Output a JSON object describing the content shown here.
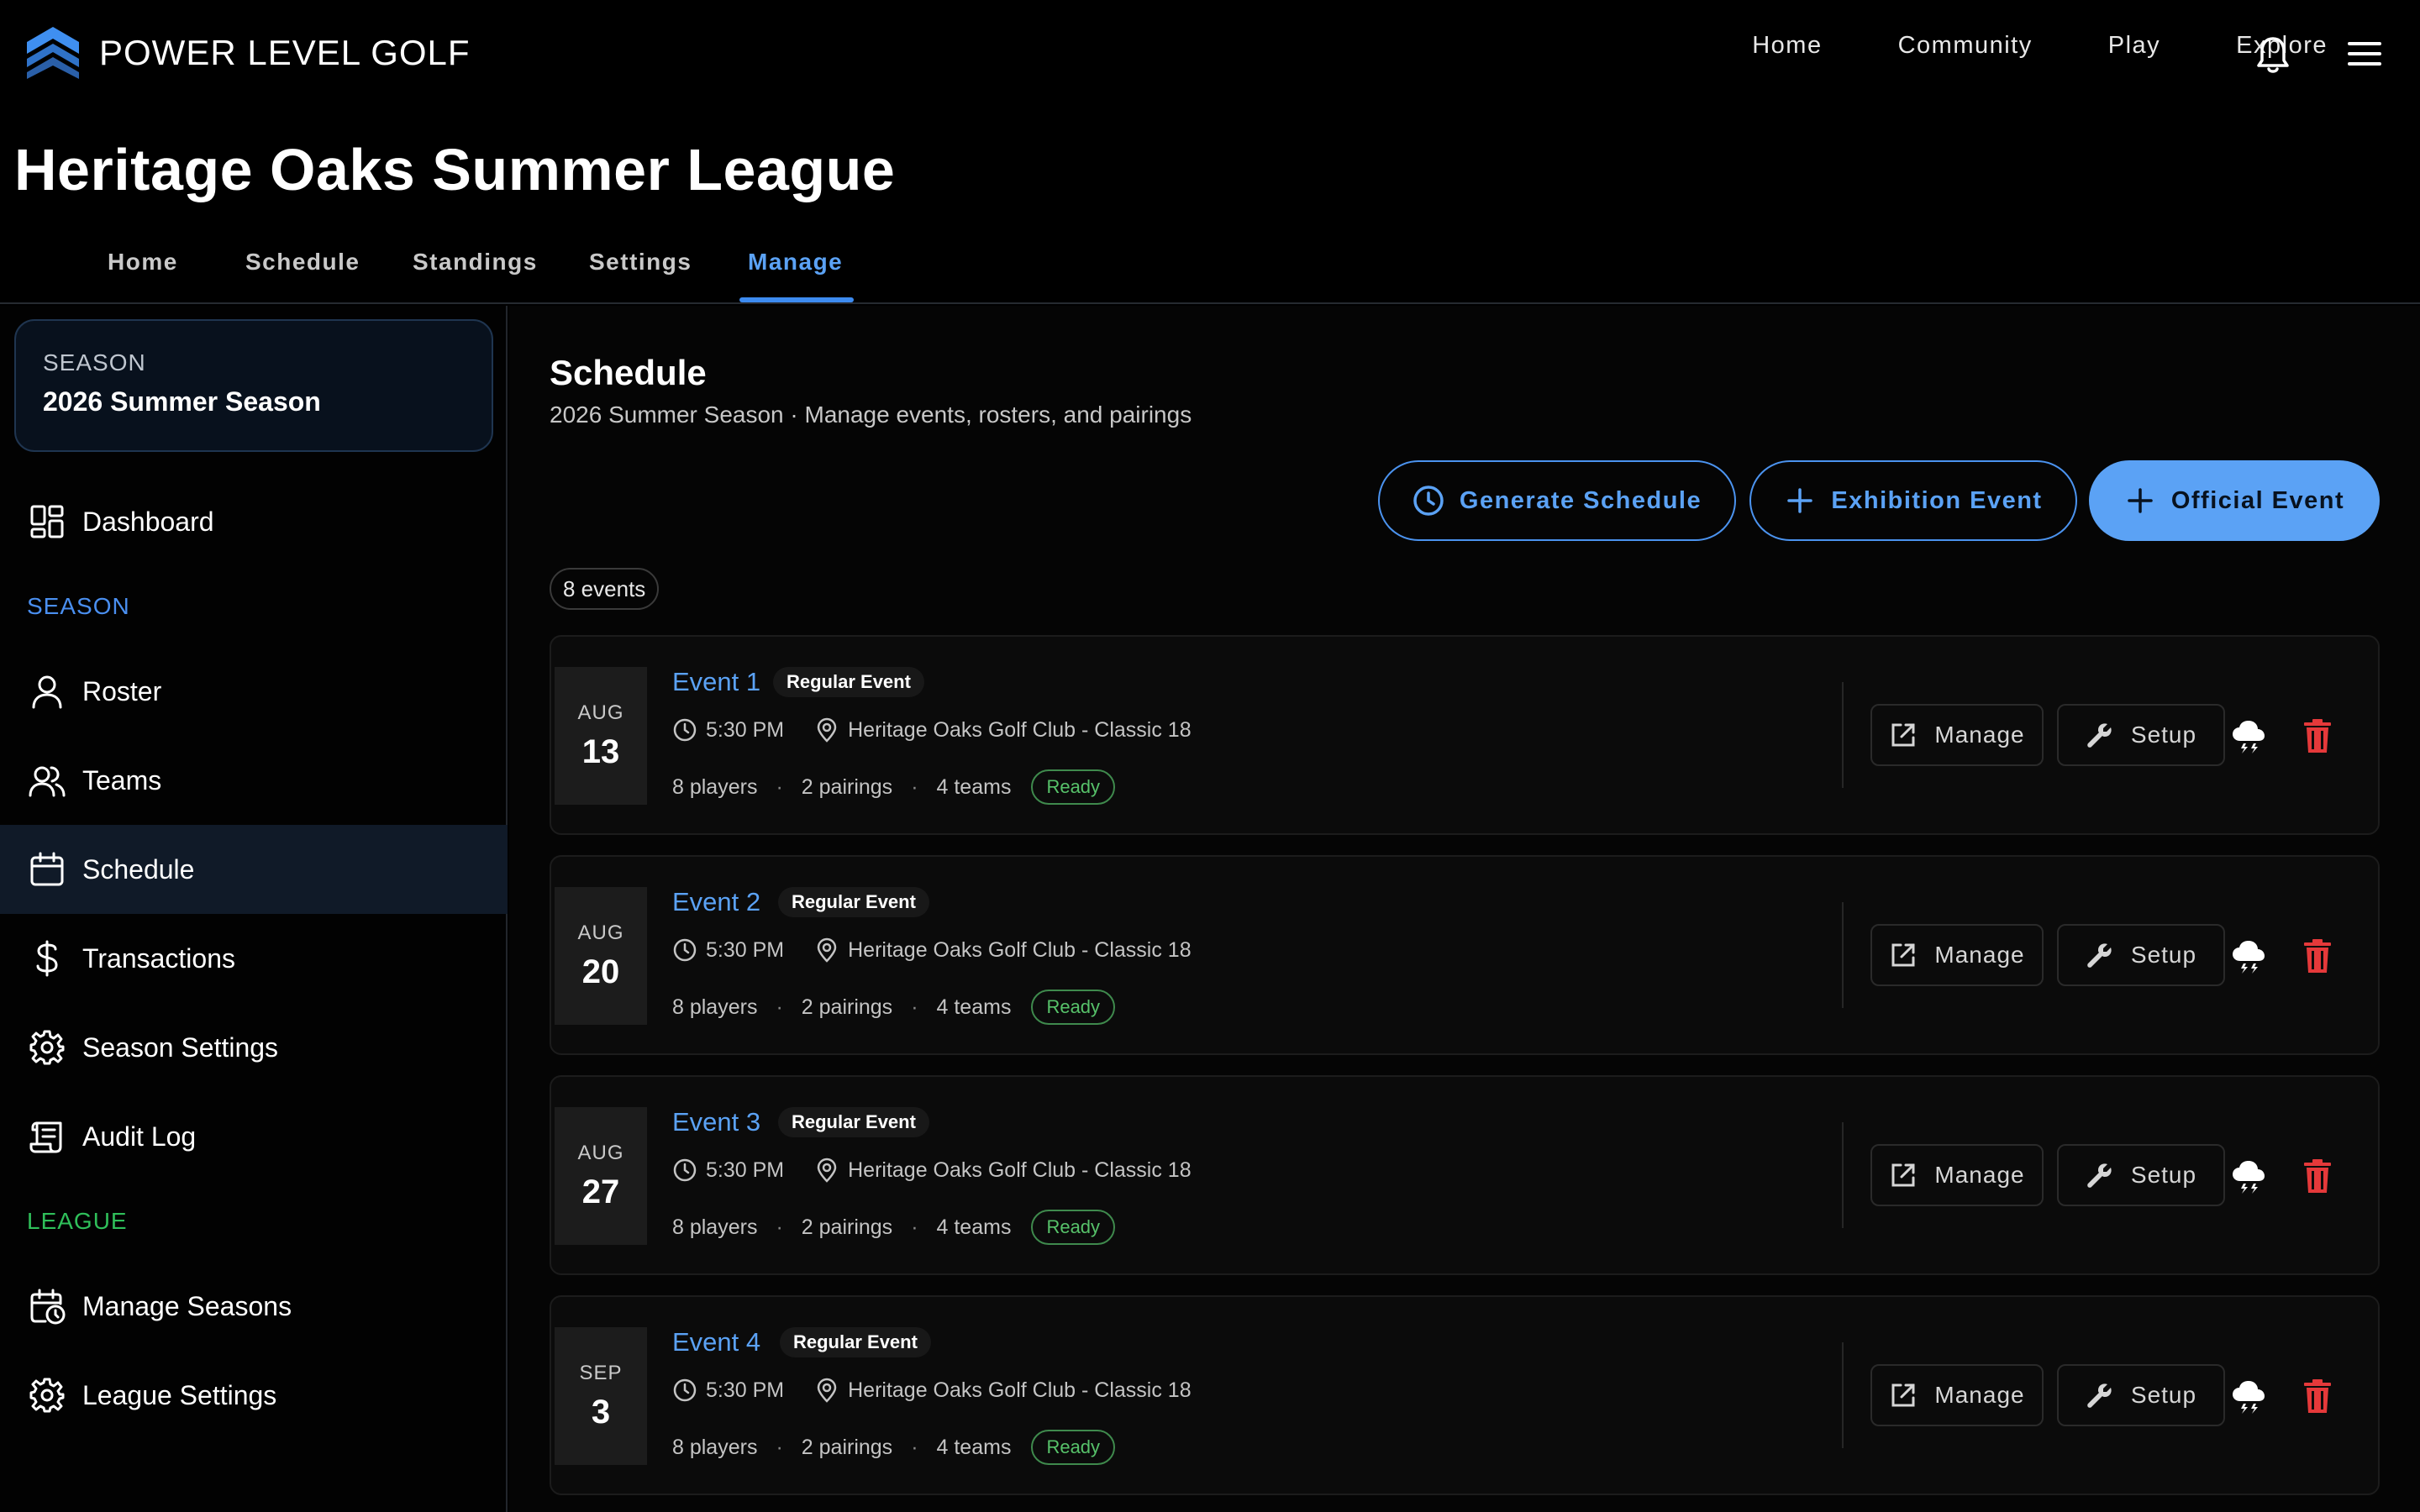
{
  "app": {
    "brand": "POWER LEVEL GOLF"
  },
  "topnav": [
    "Home",
    "Community",
    "Play",
    "Explore"
  ],
  "league": {
    "title": "Heritage Oaks Summer League",
    "tabs": [
      "Home",
      "Schedule",
      "Standings",
      "Settings",
      "Manage"
    ],
    "active_tab": "Manage"
  },
  "sidebar": {
    "season_label": "SEASON",
    "season_name": "2026 Summer Season",
    "dashboard": "Dashboard",
    "section_season": "SEASON",
    "season_items": [
      "Roster",
      "Teams",
      "Schedule",
      "Transactions",
      "Season Settings",
      "Audit Log"
    ],
    "active_item": "Schedule",
    "section_league": "LEAGUE",
    "league_items": [
      "Manage Seasons",
      "League Settings"
    ]
  },
  "main": {
    "title": "Schedule",
    "subtitle": "2026 Summer Season · Manage events, rosters, and pairings",
    "buttons": {
      "generate": "Generate Schedule",
      "exhibition": "Exhibition Event",
      "official": "Official Event"
    },
    "count": "8 events",
    "actions": {
      "manage": "Manage",
      "setup": "Setup"
    },
    "events": [
      {
        "month": "AUG",
        "day": "13",
        "title": "Event 1",
        "badge": "Regular Event",
        "time": "5:30 PM",
        "course": "Heritage Oaks Golf Club - Classic 18",
        "players": "8 players",
        "pairings": "2 pairings",
        "teams": "4 teams",
        "status": "Ready"
      },
      {
        "month": "AUG",
        "day": "20",
        "title": "Event 2",
        "badge": "Regular Event",
        "time": "5:30 PM",
        "course": "Heritage Oaks Golf Club - Classic 18",
        "players": "8 players",
        "pairings": "2 pairings",
        "teams": "4 teams",
        "status": "Ready"
      },
      {
        "month": "AUG",
        "day": "27",
        "title": "Event 3",
        "badge": "Regular Event",
        "time": "5:30 PM",
        "course": "Heritage Oaks Golf Club - Classic 18",
        "players": "8 players",
        "pairings": "2 pairings",
        "teams": "4 teams",
        "status": "Ready"
      },
      {
        "month": "SEP",
        "day": "3",
        "title": "Event 4",
        "badge": "Regular Event",
        "time": "5:30 PM",
        "course": "Heritage Oaks Golf Club - Classic 18",
        "players": "8 players",
        "pairings": "2 pairings",
        "teams": "4 teams",
        "status": "Ready"
      }
    ]
  },
  "colors": {
    "accent": "#5ba2f5",
    "season_section": "#4a8ff0",
    "league_section": "#2fbf5a",
    "ready": "#57c26a",
    "danger": "#e5393a"
  },
  "icons": [
    "logo-icon",
    "bell-icon",
    "menu-icon",
    "dashboard-icon",
    "user-icon",
    "users-icon",
    "calendar-icon",
    "dollar-icon",
    "gear-icon",
    "scroll-icon",
    "calendar-clock-icon",
    "clock-icon",
    "plus-icon",
    "pin-icon",
    "external-link-icon",
    "wrench-icon",
    "storm-icon",
    "trash-icon"
  ]
}
